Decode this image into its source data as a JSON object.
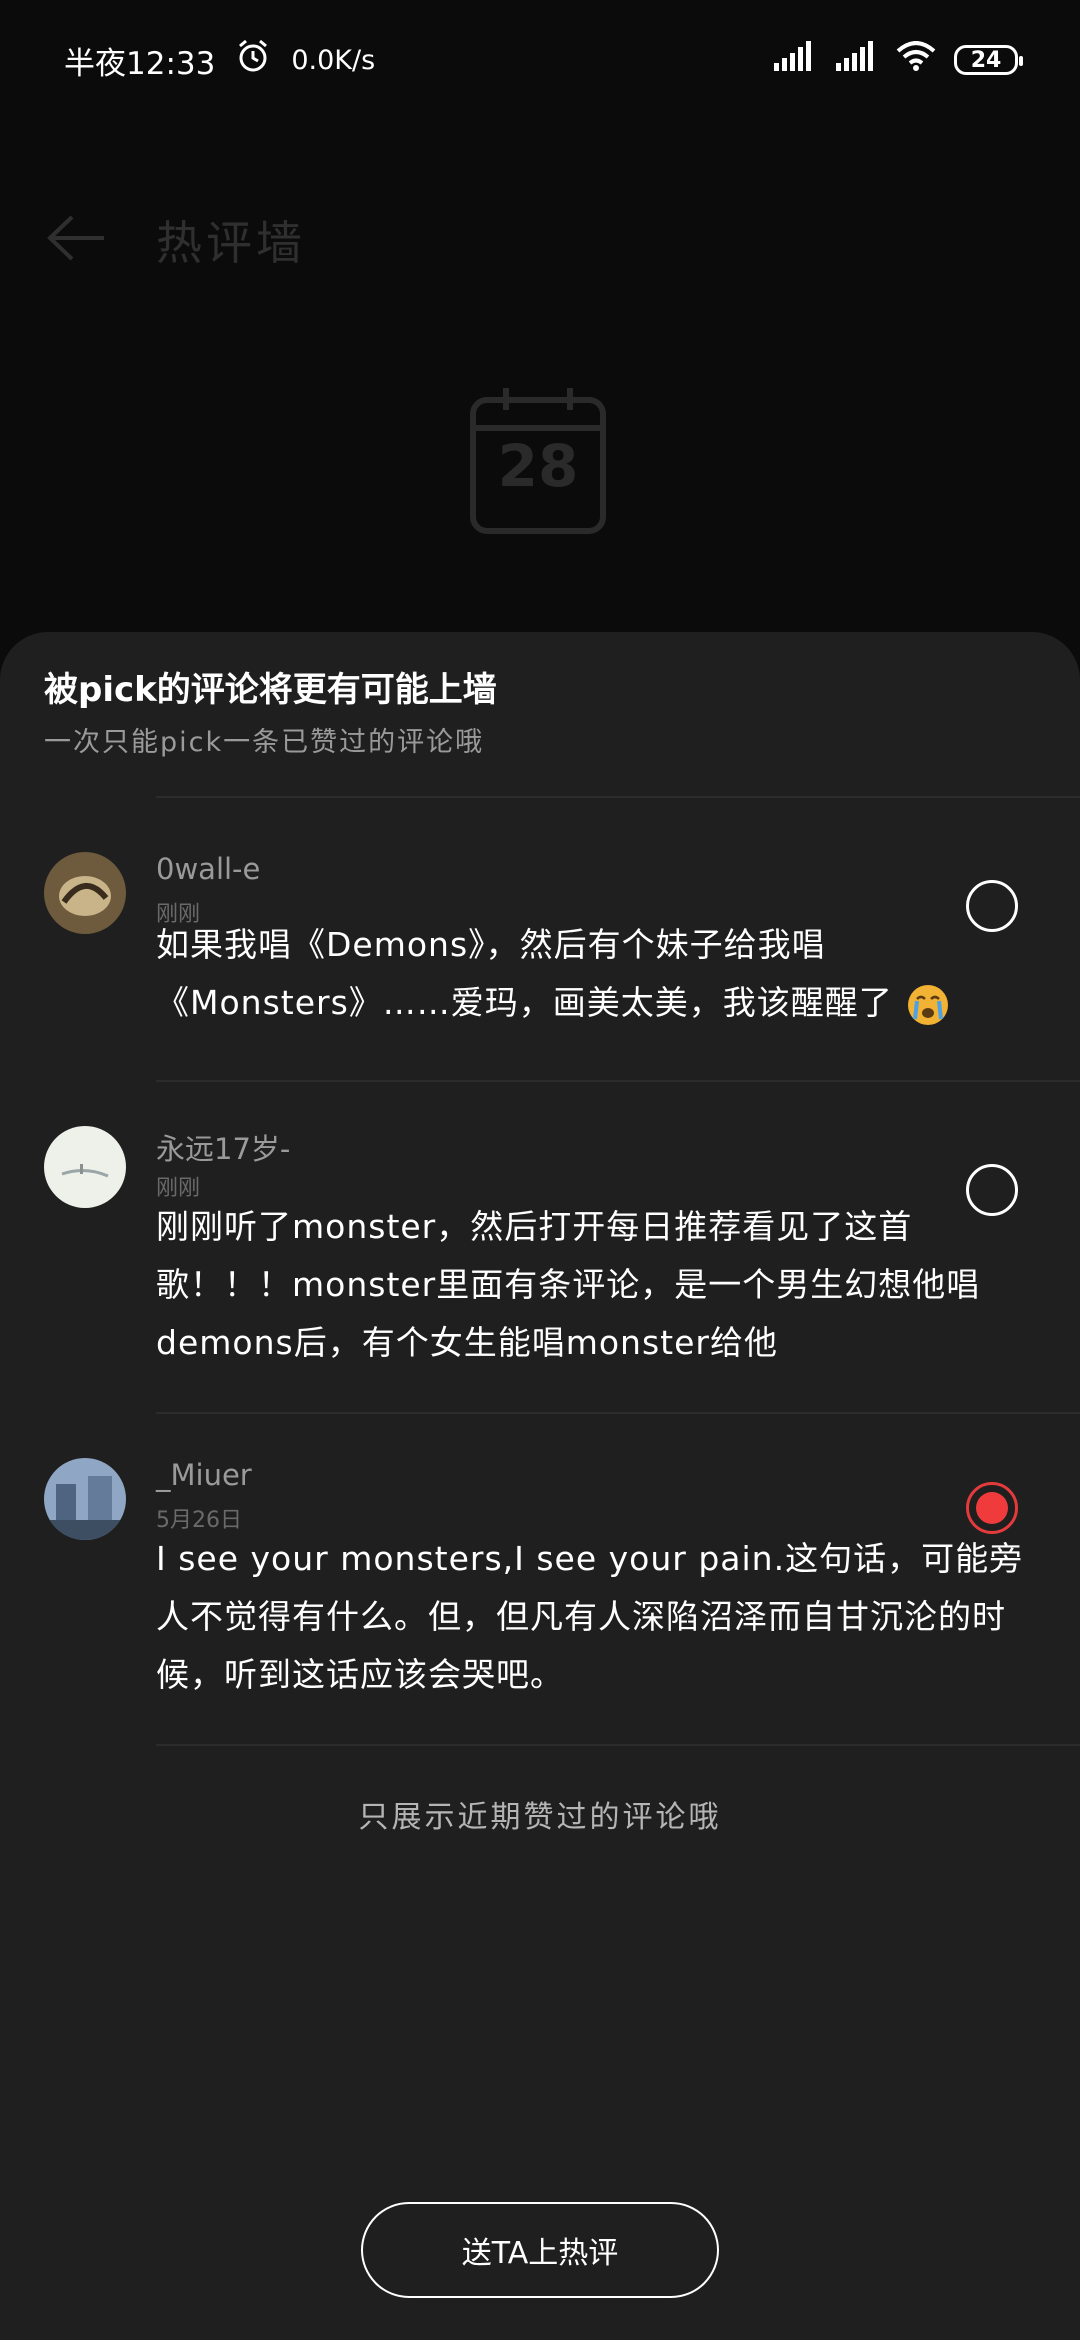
{
  "status_bar": {
    "time": "半夜12:33",
    "net_speed": "0.0K/s",
    "battery": "24"
  },
  "background_page": {
    "title": "热评墙",
    "calendar_day": "28"
  },
  "sheet": {
    "title": "被pick的评论将更有可能上墙",
    "subtitle": "一次只能pick一条已赞过的评论哦",
    "comments": [
      {
        "user": "0wall-e",
        "time": "刚刚",
        "text": "如果我唱《Demons》，然后有个妹子给我唱《Monsters》……爱玛，画美太美，我该醒醒了",
        "selected": false
      },
      {
        "user": "永远17岁-",
        "time": "刚刚",
        "text": "刚刚听了monster，然后打开每日推荐看见了这首歌！！！monster里面有条评论，是一个男生幻想他唱demons后，有个女生能唱monster给他",
        "selected": false
      },
      {
        "user": "_Miuer",
        "time": "5月26日",
        "text": "I see your monsters,I see your pain.这句话，可能旁人不觉得有什么。但，但凡有人深陷沼泽而自甘沉沦的时候，听到这话应该会哭吧。",
        "selected": true
      }
    ],
    "footer_note": "只展示近期赞过的评论哦",
    "send_button": "送TA上热评"
  },
  "colors": {
    "sheet_bg": "#1f1f1f",
    "accent_red": "#ef3b3b",
    "muted_text": "#9a9a9a"
  }
}
